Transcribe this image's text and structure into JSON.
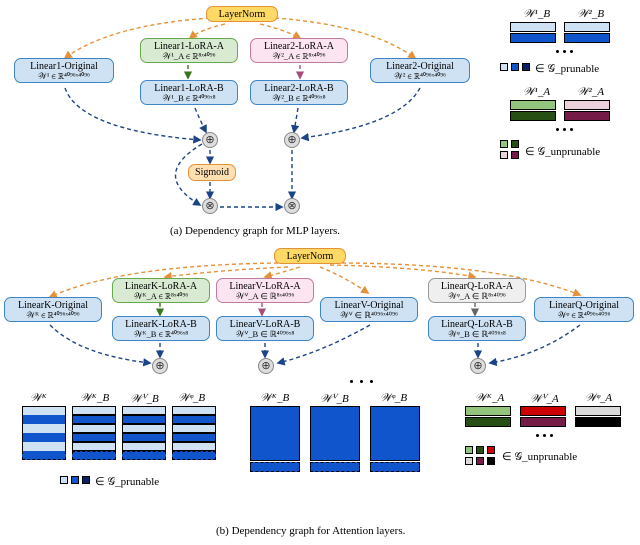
{
  "diagram_a": {
    "caption": "(a) Dependency graph for MLP layers.",
    "layernorm": "LayerNorm",
    "linear1_original": {
      "title": "Linear1-Original",
      "sub": "𝒲¹ ∈ ℝ⁴⁰⁹⁶ˣ⁴⁰⁹⁶"
    },
    "linear2_original": {
      "title": "Linear2-Original",
      "sub": "𝒲² ∈ ℝ⁴⁰⁹⁶ˣ⁴⁰⁹⁶"
    },
    "linear1_lora_a": {
      "title": "Linear1-LoRA-A",
      "sub": "𝒲¹_A ∈ ℝ⁸ˣ⁴⁰⁹⁶"
    },
    "linear1_lora_b": {
      "title": "Linear1-LoRA-B",
      "sub": "𝒲¹_B ∈ ℝ⁴⁰⁹⁶ˣ⁸"
    },
    "linear2_lora_a": {
      "title": "Linear2-LoRA-A",
      "sub": "𝒲²_A ∈ ℝ⁸ˣ⁴⁰⁹⁶"
    },
    "linear2_lora_b": {
      "title": "Linear2-LoRA-B",
      "sub": "𝒲²_B ∈ ℝ⁴⁰⁹⁶ˣ⁸"
    },
    "sigmoid": "Sigmoid",
    "legend_right": {
      "w1b": "𝒲¹_B",
      "w2b": "𝒲²_B",
      "prunable": "∈ 𝒢_prunable",
      "w1a": "𝒲¹_A",
      "w2a": "𝒲²_A",
      "unprunable": "∈ 𝒢_unprunable"
    }
  },
  "diagram_b": {
    "caption": "(b) Dependency graph for Attention layers.",
    "layernorm": "LayerNorm",
    "linearK_original": {
      "title": "LinearK-Original",
      "sub": "𝒲ᴷ ∈ ℝ⁴⁰⁹⁶ˣ⁴⁰⁹⁶"
    },
    "linearV_original": {
      "title": "LinearV-Original",
      "sub": "𝒲ⱽ ∈ ℝ⁴⁰⁹⁶ˣ⁴⁰⁹⁶"
    },
    "linearQ_original": {
      "title": "LinearQ-Original",
      "sub": "𝒲ᵠ ∈ ℝ⁴⁰⁹⁶ˣ⁴⁰⁹⁶"
    },
    "linearK_lora_a": {
      "title": "LinearK-LoRA-A",
      "sub": "𝒲ᴷ_A ∈ ℝ⁸ˣ⁴⁰⁹⁶"
    },
    "linearK_lora_b": {
      "title": "LinearK-LoRA-B",
      "sub": "𝒲ᴷ_B ∈ ℝ⁴⁰⁹⁶ˣ⁸"
    },
    "linearV_lora_a": {
      "title": "LinearV-LoRA-A",
      "sub": "𝒲ⱽ_A ∈ ℝ⁸ˣ⁴⁰⁹⁶"
    },
    "linearV_lora_b": {
      "title": "LinearV-LoRA-B",
      "sub": "𝒲ⱽ_B ∈ ℝ⁴⁰⁹⁶ˣ⁸"
    },
    "linearQ_lora_a": {
      "title": "LinearQ-LoRA-A",
      "sub": "𝒲ᵠ_A ∈ ℝ⁸ˣ⁴⁰⁹⁶"
    },
    "linearQ_lora_b": {
      "title": "LinearQ-LoRA-B",
      "sub": "𝒲ᵠ_B ∈ ℝ⁴⁰⁹⁶ˣ⁸"
    },
    "legend_left": {
      "wk": "𝒲ᴷ",
      "wkb": "𝒲ᴷ_B",
      "wvb": "𝒲ⱽ_B",
      "wqb": "𝒲ᵠ_B",
      "prunable": "∈ 𝒢_prunable"
    },
    "legend_center": {
      "wkb": "𝒲ᴷ_B",
      "wvb": "𝒲ⱽ_B",
      "wqb": "𝒲ᵠ_B"
    },
    "legend_right": {
      "wka": "𝒲ᴷ_A",
      "wva": "𝒲ⱽ_A",
      "wqa": "𝒲ᵠ_A",
      "unprunable": "∈ 𝒢_unprunable"
    }
  },
  "colors": {
    "orange_arrow": "#e69138",
    "blue_arrow": "#1c4587",
    "green_arrow": "#38761d",
    "pink_arrow": "#a64d79",
    "grey_arrow": "#666666",
    "lightblue_fill": "#cfe2f3",
    "midblue": "#1155cc",
    "darkblue": "#0b1f66",
    "green_light": "#93c47d",
    "green_dark": "#274e13",
    "pink_light": "#ead1dc",
    "pink_dark": "#741b47",
    "red_mid": "#cc0000",
    "grey_light": "#d9d9d9",
    "black": "#000000"
  },
  "chart_data": {
    "type": "diagram",
    "panels": [
      {
        "id": "a",
        "title": "Dependency graph for MLP layers.",
        "nodes": [
          {
            "id": "LN",
            "label": "LayerNorm"
          },
          {
            "id": "L1O",
            "label": "Linear1-Original",
            "shape": "𝒲¹ ∈ ℝ^{4096×4096}"
          },
          {
            "id": "L2O",
            "label": "Linear2-Original",
            "shape": "𝒲² ∈ ℝ^{4096×4096}"
          },
          {
            "id": "L1A",
            "label": "Linear1-LoRA-A",
            "shape": "𝒲¹_A ∈ ℝ^{8×4096}"
          },
          {
            "id": "L1B",
            "label": "Linear1-LoRA-B",
            "shape": "𝒲¹_B ∈ ℝ^{4096×8}"
          },
          {
            "id": "L2A",
            "label": "Linear2-LoRA-A",
            "shape": "𝒲²_A ∈ ℝ^{8×4096}"
          },
          {
            "id": "L2B",
            "label": "Linear2-LoRA-B",
            "shape": "𝒲²_B ∈ ℝ^{4096×8}"
          },
          {
            "id": "SIG",
            "label": "Sigmoid"
          },
          {
            "id": "ADD1",
            "label": "⊕"
          },
          {
            "id": "ADD2",
            "label": "⊕"
          },
          {
            "id": "MUL1",
            "label": "⊗"
          },
          {
            "id": "MUL2",
            "label": "⊗"
          }
        ],
        "edges": [
          [
            "LN",
            "L1O",
            "orange"
          ],
          [
            "LN",
            "L1A",
            "orange"
          ],
          [
            "LN",
            "L2A",
            "orange"
          ],
          [
            "LN",
            "L2O",
            "orange"
          ],
          [
            "L1A",
            "L1B",
            "green"
          ],
          [
            "L2A",
            "L2B",
            "pink"
          ],
          [
            "L1O",
            "ADD1",
            "blue"
          ],
          [
            "L1B",
            "ADD1",
            "blue"
          ],
          [
            "L2O",
            "ADD2",
            "blue"
          ],
          [
            "L2B",
            "ADD2",
            "blue"
          ],
          [
            "ADD1",
            "SIG",
            "blue"
          ],
          [
            "SIG",
            "MUL1",
            "blue"
          ],
          [
            "ADD1",
            "MUL1",
            "blue"
          ],
          [
            "ADD2",
            "MUL2",
            "blue"
          ],
          [
            "MUL1",
            "MUL2",
            "blue"
          ]
        ],
        "legend": {
          "prunable": [
            "𝒲¹_B",
            "𝒲²_B"
          ],
          "unprunable": [
            "𝒲¹_A",
            "𝒲²_A"
          ]
        }
      },
      {
        "id": "b",
        "title": "Dependency graph for Attention layers.",
        "nodes": [
          {
            "id": "LN",
            "label": "LayerNorm"
          },
          {
            "id": "KO",
            "label": "LinearK-Original",
            "shape": "𝒲ᴷ ∈ ℝ^{4096×4096}"
          },
          {
            "id": "VO",
            "label": "LinearV-Original",
            "shape": "𝒲ⱽ ∈ ℝ^{4096×4096}"
          },
          {
            "id": "QO",
            "label": "LinearQ-Original",
            "shape": "𝒲ᵠ ∈ ℝ^{4096×4096}"
          },
          {
            "id": "KA",
            "label": "LinearK-LoRA-A",
            "shape": "𝒲ᴷ_A ∈ ℝ^{8×4096}"
          },
          {
            "id": "KB",
            "label": "LinearK-LoRA-B",
            "shape": "𝒲ᴷ_B ∈ ℝ^{4096×8}"
          },
          {
            "id": "VA",
            "label": "LinearV-LoRA-A",
            "shape": "𝒲ⱽ_A ∈ ℝ^{8×4096}"
          },
          {
            "id": "VB",
            "label": "LinearV-LoRA-B",
            "shape": "𝒲ⱽ_B ∈ ℝ^{4096×8}"
          },
          {
            "id": "QA",
            "label": "LinearQ-LoRA-A",
            "shape": "𝒲ᵠ_A ∈ ℝ^{8×4096}"
          },
          {
            "id": "QB",
            "label": "LinearQ-LoRA-B",
            "shape": "𝒲ᵠ_B ∈ ℝ^{4096×8}"
          },
          {
            "id": "ADDK",
            "label": "⊕"
          },
          {
            "id": "ADDV",
            "label": "⊕"
          },
          {
            "id": "ADDQ",
            "label": "⊕"
          }
        ],
        "edges": [
          [
            "LN",
            "KO",
            "orange"
          ],
          [
            "LN",
            "KA",
            "orange"
          ],
          [
            "LN",
            "VA",
            "orange"
          ],
          [
            "LN",
            "VO",
            "orange"
          ],
          [
            "LN",
            "QA",
            "orange"
          ],
          [
            "LN",
            "QO",
            "orange"
          ],
          [
            "KA",
            "KB",
            "green"
          ],
          [
            "VA",
            "VB",
            "pink"
          ],
          [
            "QA",
            "QB",
            "grey"
          ],
          [
            "KO",
            "ADDK",
            "blue"
          ],
          [
            "KB",
            "ADDK",
            "blue"
          ],
          [
            "VO",
            "ADDV",
            "blue"
          ],
          [
            "VB",
            "ADDV",
            "blue"
          ],
          [
            "QO",
            "ADDQ",
            "blue"
          ],
          [
            "QB",
            "ADDQ",
            "blue"
          ]
        ],
        "legend": {
          "prunable": [
            "𝒲ᴷ",
            "𝒲ᴷ_B",
            "𝒲ⱽ_B",
            "𝒲ᵠ_B"
          ],
          "unprunable": [
            "𝒲ᴷ_A",
            "𝒲ⱽ_A",
            "𝒲ᵠ_A"
          ]
        }
      }
    ]
  }
}
